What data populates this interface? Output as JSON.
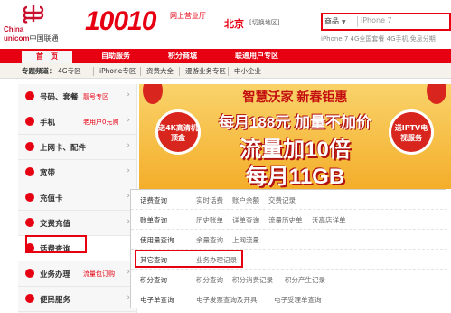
{
  "header": {
    "brand_cn": "中国联通",
    "brand_en_a": "China",
    "brand_en_b": "unicom",
    "hotline": "10010",
    "tagline": "网上营业厅",
    "city": "北京",
    "city_switch": "[切换地区]",
    "search_category": "商品",
    "search_placeholder": "iPhone 7",
    "hot_words": "iPhone 7  4G全国套餐  4G手机  免息分期"
  },
  "nav": {
    "items": [
      {
        "label": "首　页"
      },
      {
        "label": "自助服务"
      },
      {
        "label": "积分商城"
      },
      {
        "label": "联通用户专区"
      }
    ]
  },
  "subnav": {
    "prefix": "专题频道：",
    "items": [
      "4G专区",
      "iPhone专区",
      "资费大全",
      "漫游业务专区",
      "中小企业"
    ]
  },
  "sidebar": {
    "items": [
      {
        "label": "号码、套餐",
        "tag": "靓号专区"
      },
      {
        "label": "手机",
        "tag": "老用户0元购"
      },
      {
        "label": "上网卡、配件",
        "tag": ""
      },
      {
        "label": "宽带",
        "tag": ""
      },
      {
        "label": "充值卡",
        "tag": ""
      },
      {
        "label": "交费充值",
        "tag": ""
      },
      {
        "label": "话费查询",
        "tag": ""
      },
      {
        "label": "业务办理",
        "tag": "流量包订购"
      },
      {
        "label": "便民服务",
        "tag": ""
      }
    ]
  },
  "banner": {
    "headline": "智慧沃家 新春钜惠",
    "line2": "每月188元 加量不加价",
    "line3": "流量加10倍",
    "line4": "每月11GB",
    "left_badge": "送4K高清机顶盒",
    "right_badge": "送IPTV电视服务"
  },
  "panel": {
    "rows": [
      {
        "key": "话费查询",
        "values": [
          "实时话费",
          "账户余额",
          "交费记录"
        ]
      },
      {
        "key": "账单查询",
        "values": [
          "历史账单",
          "详单查询",
          "流量历史单",
          "沃高店详单"
        ]
      },
      {
        "key": "使用量查询",
        "values": [
          "余量查询",
          "上网流量"
        ]
      },
      {
        "key": "其它查询",
        "values": [
          "业务办理记录"
        ]
      },
      {
        "key": "积分查询",
        "values": [
          "积分查询",
          "积分消费记录",
          "积分产生记录"
        ]
      },
      {
        "key": "电子单查询",
        "values": [
          "电子发票查询及开具",
          "电子受理单查询"
        ]
      }
    ]
  },
  "colors": {
    "accent": "#e60012"
  }
}
